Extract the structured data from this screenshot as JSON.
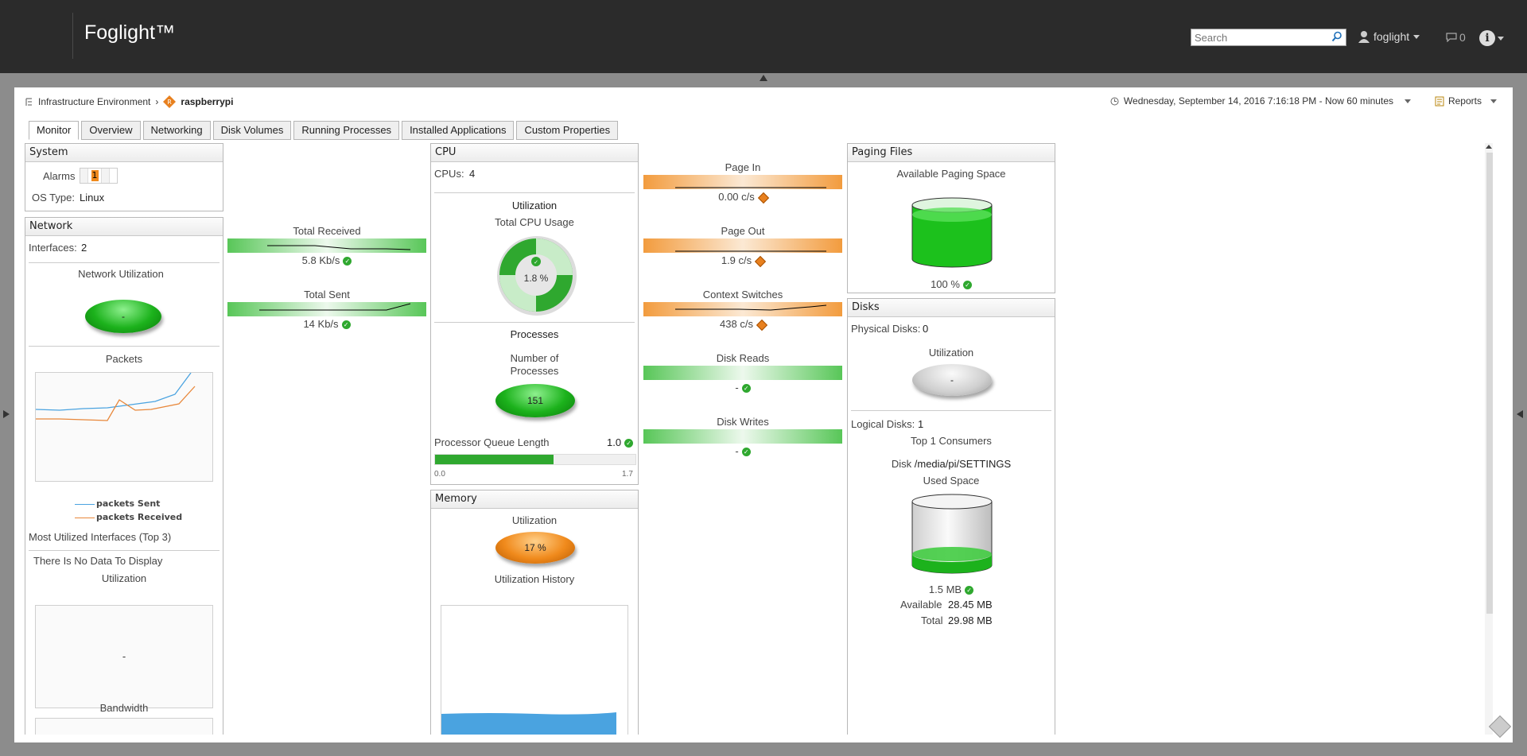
{
  "app": {
    "brand": "Foglight™"
  },
  "header": {
    "search_placeholder": "Search",
    "user": "foglight",
    "messages": "0"
  },
  "breadcrumb": {
    "parent": "Infrastructure Environment",
    "current": "raspberrypi"
  },
  "timerange": "Wednesday, September 14, 2016 7:16:18 PM - Now 60 minutes",
  "reports_label": "Reports",
  "tabs": [
    "Monitor",
    "Overview",
    "Networking",
    "Disk Volumes",
    "Running Processes",
    "Installed Applications",
    "Custom Properties"
  ],
  "system": {
    "title": "System",
    "alarms_label": "Alarms",
    "alarm_counts": [
      "",
      "1",
      "",
      ""
    ],
    "os_label": "OS Type:",
    "os_value": "Linux"
  },
  "network": {
    "title": "Network",
    "interfaces_label": "Interfaces:",
    "interfaces_value": "2",
    "utilization_label": "Network Utilization",
    "utilization_value": "-",
    "packets_label": "Packets",
    "legend": [
      "packets Sent",
      "packets Received"
    ],
    "most_utilized": "Most Utilized Interfaces (Top 3)",
    "no_data": "There Is No Data To Display",
    "utilization2": "Utilization",
    "utilization2_value": "-",
    "bandwidth": "Bandwidth",
    "series_colors": {
      "sent": "#4aa3e0",
      "received": "#e8873a"
    }
  },
  "traffic": {
    "received_label": "Total Received",
    "received_value": "5.8 Kb/s",
    "sent_label": "Total Sent",
    "sent_value": "14 Kb/s"
  },
  "cpu": {
    "title": "CPU",
    "cpus_label": "CPUs:",
    "cpus_value": "4",
    "utilization_heading": "Utilization",
    "total_usage_label": "Total CPU Usage",
    "total_usage_value": "1.8 %",
    "processes_heading": "Processes",
    "num_processes_label": "Number of Processes",
    "num_processes_value": "151",
    "queue_label": "Processor Queue Length",
    "queue_value": "1.0",
    "queue_min": "0.0",
    "queue_max": "1.7",
    "queue_fill": 0.59
  },
  "memory": {
    "title": "Memory",
    "utilization_label": "Utilization",
    "utilization_value": "17 %",
    "history_label": "Utilization History"
  },
  "paging": {
    "pagein_label": "Page In",
    "pagein_value": "0.00 c/s",
    "pageout_label": "Page Out",
    "pageout_value": "1.9 c/s",
    "ctx_label": "Context Switches",
    "ctx_value": "438 c/s",
    "diskreads_label": "Disk Reads",
    "diskreads_value": "-",
    "diskwrites_label": "Disk Writes",
    "diskwrites_value": "-"
  },
  "pagingfiles": {
    "title": "Paging Files",
    "available_label": "Available Paging Space",
    "available_value": "100 %"
  },
  "disks": {
    "title": "Disks",
    "physical_label": "Physical Disks:",
    "physical_value": "0",
    "utilization_label": "Utilization",
    "utilization_value": "-",
    "logical_label": "Logical Disks:",
    "logical_value": "1",
    "top_consumers": "Top 1 Consumers",
    "disk_label": "Disk",
    "disk_path": "/media/pi/SETTINGS",
    "used_space_label": "Used Space",
    "used_value": "1.5 MB",
    "available_label": "Available",
    "available_value": "28.45 MB",
    "total_label": "Total",
    "total_value": "29.98 MB"
  }
}
